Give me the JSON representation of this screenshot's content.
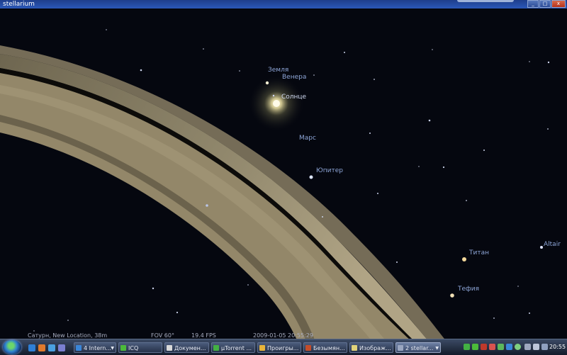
{
  "window": {
    "title": "stellarium",
    "controls": {
      "minimize": "_",
      "maximize": "□",
      "close": "x"
    }
  },
  "sky": {
    "labels": {
      "earth": "Земля",
      "venus": "Венера",
      "sun": "Солнце",
      "mars": "Марс",
      "jupiter": "Юпитер",
      "titan": "Титан",
      "tethys": "Тефия",
      "altair": "Altair"
    }
  },
  "status": {
    "location": "Сатурн, New Location, 38m",
    "fov": "FOV 60°",
    "fps": "19.4 FPS",
    "datetime": "2009-01-05   20:55:29"
  },
  "taskbar": {
    "tasks": [
      {
        "label": "4 Intern...",
        "icon_color": "#3a86d9"
      },
      {
        "label": "ICQ",
        "icon_color": "#4cbb3a"
      },
      {
        "label": "Докумен...",
        "icon_color": "#d9d9d9"
      },
      {
        "label": "µTorrent ...",
        "icon_color": "#43b043"
      },
      {
        "label": "Проигры...",
        "icon_color": "#e8b43a"
      },
      {
        "label": "Безымян...",
        "icon_color": "#c44d2a"
      },
      {
        "label": "Изображ...",
        "icon_color": "#e0d27a"
      },
      {
        "label": "2 stellar...",
        "icon_color": "#9aa6c0"
      }
    ],
    "clock": "20:55"
  }
}
